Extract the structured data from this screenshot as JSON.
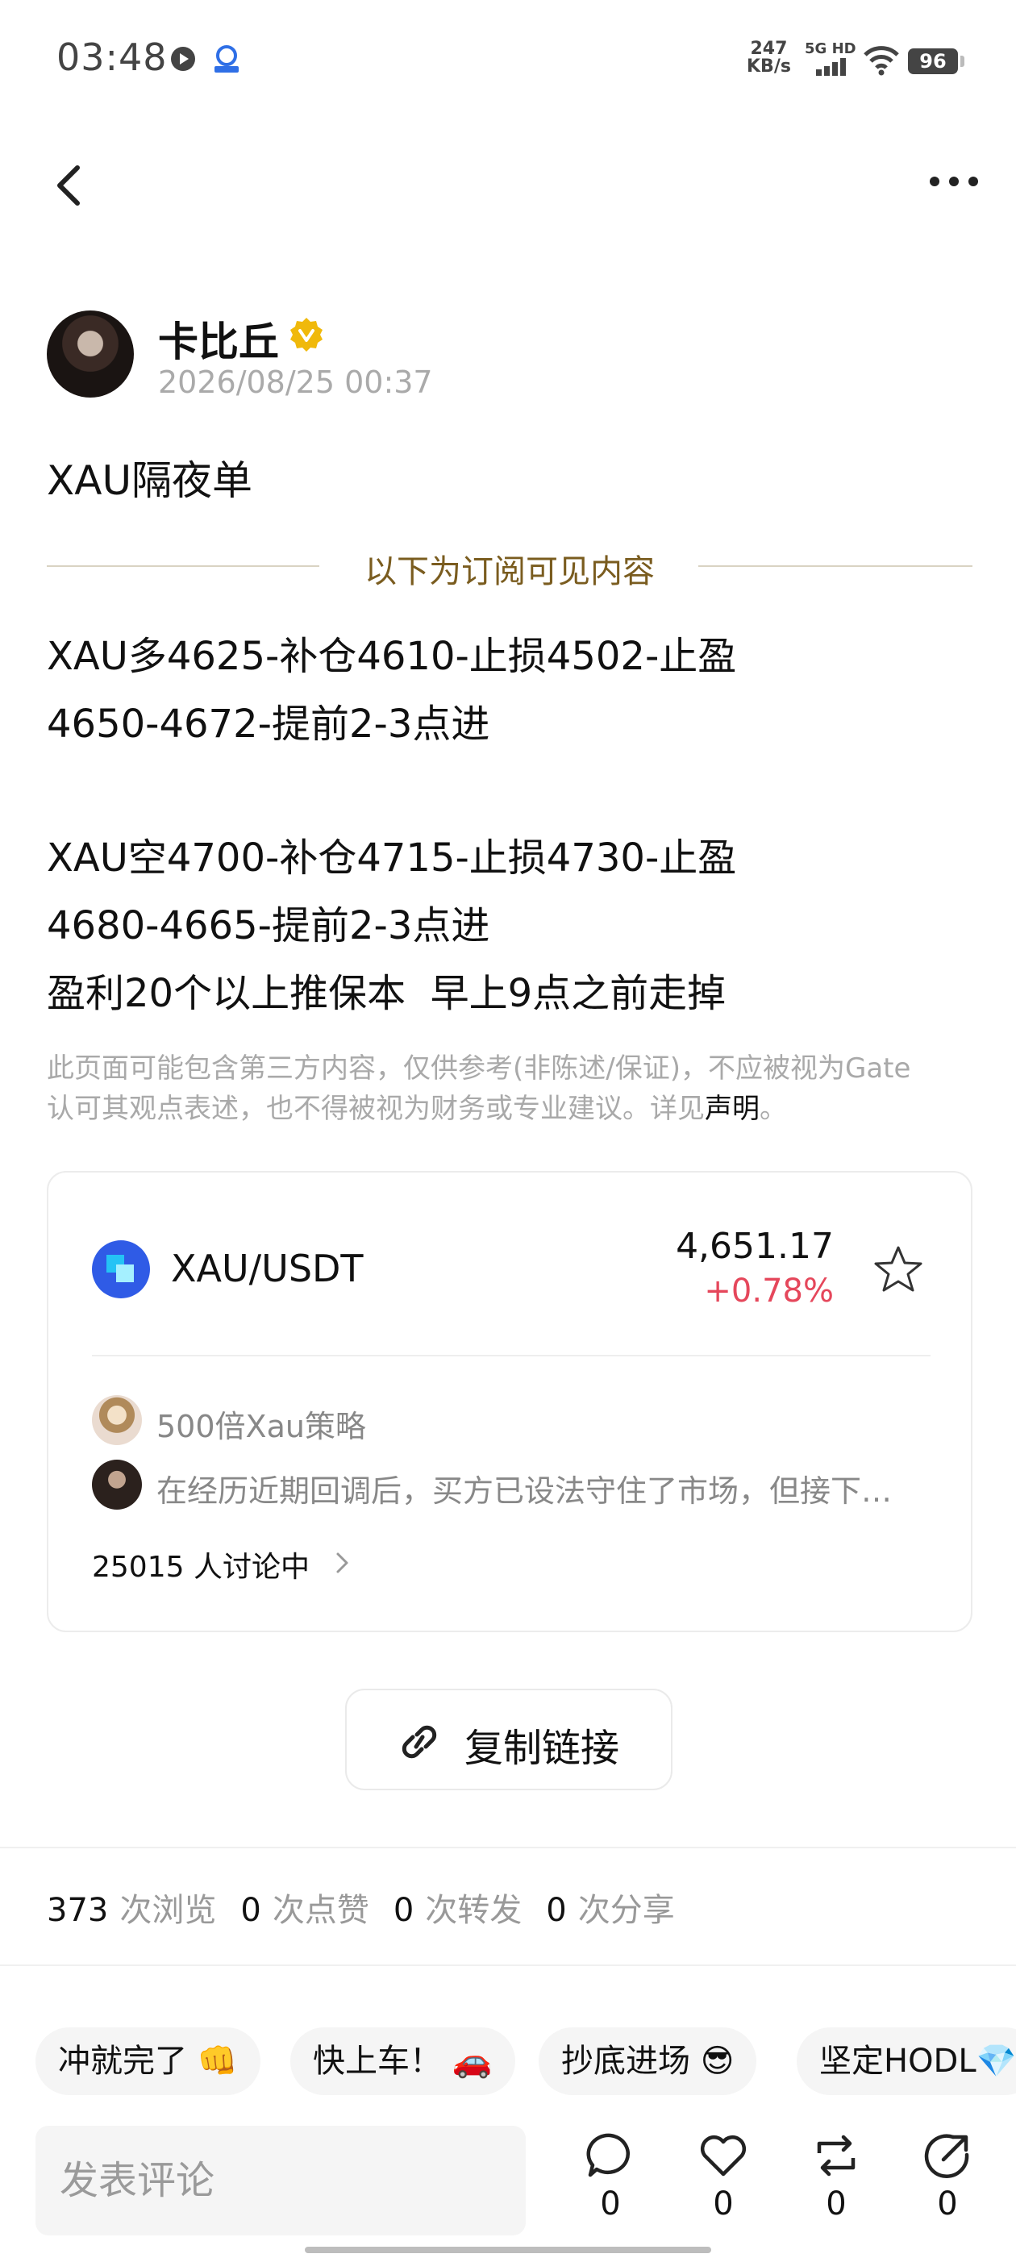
{
  "status_bar": {
    "time": "03:48",
    "net_speed_value": "247",
    "net_speed_unit": "KB/s",
    "signal_label": "5G HD",
    "battery": "96"
  },
  "author": {
    "name": "卡比丘",
    "time": "2026/08/25 00:37"
  },
  "post": {
    "title": "XAU隔夜单",
    "divider_text": "以下为订阅可见内容",
    "lines": [
      "XAU多4625-补仓4610-止损4502-止盈",
      "4650-4672-提前2-3点进",
      "XAU空4700-补仓4715-止损4730-止盈",
      "4680-4665-提前2-3点进",
      "盈利20个以上推保本  早上9点之前走掉"
    ],
    "disclaimer_line1": "此页面可能包含第三方内容，仅供参考(非陈述/保证)，不应被视为Gate",
    "disclaimer_line2": "认可其观点表述，也不得被视为财务或专业建议。详见",
    "disclaimer_link": "声明",
    "disclaimer_end": "。"
  },
  "market_card": {
    "pair": "XAU/USDT",
    "price": "4,651.17",
    "change": "+0.78%",
    "comments": [
      "500倍Xau策略",
      "在经历近期回调后，买方已设法守住了市场，但接下…"
    ],
    "discussion": "25015 人讨论中"
  },
  "copy_link_label": "复制链接",
  "stats": {
    "views": "373",
    "views_label": "次浏览",
    "likes": "0",
    "likes_label": "次点赞",
    "reposts": "0",
    "reposts_label": "次转发",
    "shares": "0",
    "shares_label": "次分享"
  },
  "chips": [
    "冲就完了 👊",
    "快上车！ 🚗",
    "抄底进场 😎",
    "坚定HODL💎"
  ],
  "bottom_bar": {
    "comment_placeholder": "发表评论",
    "comment_count": "0",
    "like_count": "0",
    "repost_count": "0",
    "share_count": "0"
  },
  "colors": {
    "accent_gold": "#7a5c1f",
    "change_red": "#e5475b",
    "coin_blue": "#2f5be6",
    "verified_gold": "#f0b90b"
  }
}
